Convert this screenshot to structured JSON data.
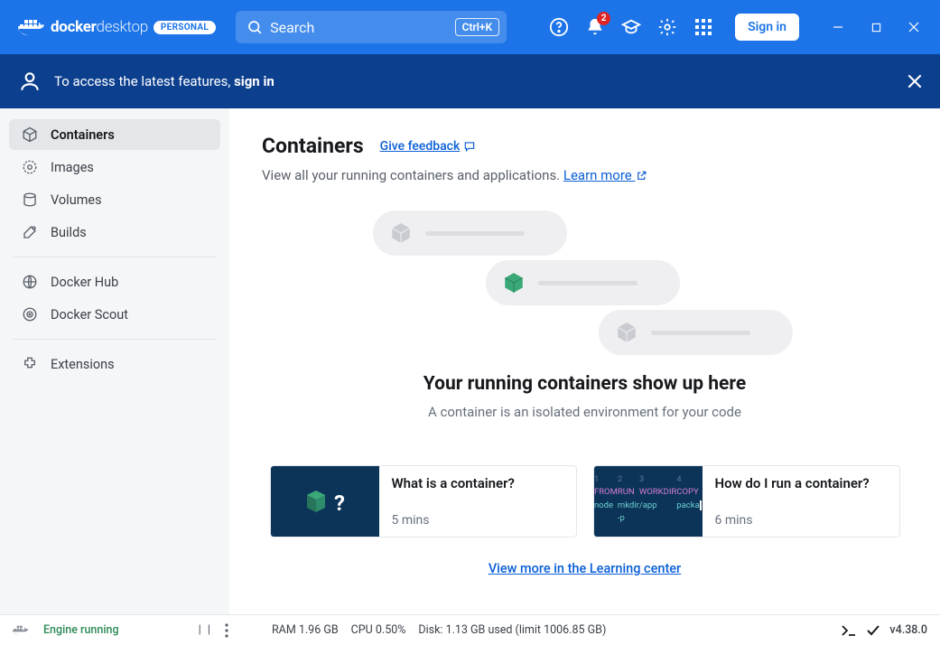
{
  "titlebar": {
    "brand_bold": "docker",
    "brand_light": "desktop",
    "plan_badge": "PERSONAL",
    "search_placeholder": "Search",
    "search_shortcut": "Ctrl+K",
    "notif_count": "2",
    "signin_label": "Sign in"
  },
  "banner": {
    "prefix": "To access the latest features,",
    "action": "sign in"
  },
  "sidebar": {
    "items": [
      {
        "label": "Containers",
        "active": true
      },
      {
        "label": "Images"
      },
      {
        "label": "Volumes"
      },
      {
        "label": "Builds"
      }
    ],
    "items2": [
      {
        "label": "Docker Hub"
      },
      {
        "label": "Docker Scout"
      }
    ],
    "items3": [
      {
        "label": "Extensions"
      }
    ]
  },
  "main": {
    "title": "Containers",
    "feedback": "Give feedback",
    "subtitle_text": "View all your running containers and applications. ",
    "learn_more": "Learn more",
    "empty_title": "Your running containers show up here",
    "empty_sub": "A container is an isolated environment for your code",
    "cards": [
      {
        "title": "What is a container?",
        "time": "5 mins"
      },
      {
        "title": "How do I run a container?",
        "time": "6 mins"
      }
    ],
    "code_lines": [
      "FROM node",
      "RUN mkdir -p",
      "WORKDIR /app",
      "COPY packa"
    ],
    "view_more": "View more in the Learning center"
  },
  "status": {
    "engine": "Engine running",
    "ram": "RAM 1.96 GB",
    "cpu": "CPU 0.50%",
    "disk": "Disk: 1.13 GB used (limit 1006.85 GB)",
    "version": "v4.38.0"
  }
}
